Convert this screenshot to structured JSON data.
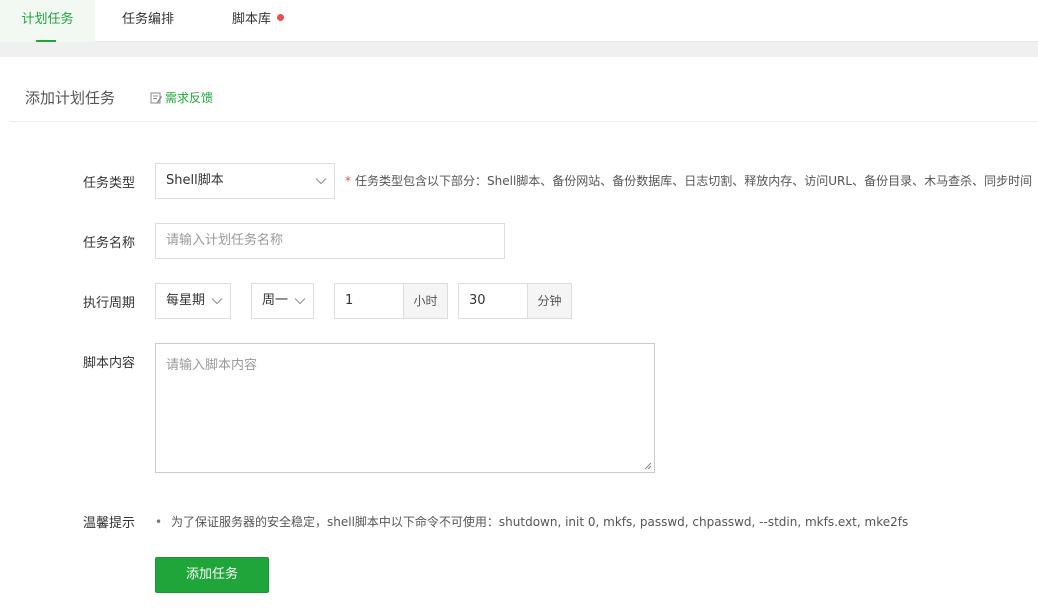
{
  "tabs": [
    {
      "label": "计划任务",
      "active": true
    },
    {
      "label": "任务编排",
      "active": false
    },
    {
      "label": "脚本库",
      "active": false,
      "badge_dot": true
    }
  ],
  "panel": {
    "title": "添加计划任务",
    "feedback_label": "需求反馈",
    "feedback_icon": "edit-icon"
  },
  "form": {
    "task_type": {
      "label": "任务类型",
      "value": "Shell脚本",
      "hint_star": "*",
      "hint": "任务类型包含以下部分：Shell脚本、备份网站、备份数据库、日志切割、释放内存、访问URL、备份目录、木马查杀、同步时间"
    },
    "task_name": {
      "label": "任务名称",
      "placeholder": "请输入计划任务名称",
      "value": ""
    },
    "period": {
      "label": "执行周期",
      "cycle": "每星期",
      "weekday": "周一",
      "hour": "1",
      "hour_unit": "小时",
      "minute": "30",
      "minute_unit": "分钟"
    },
    "script": {
      "label": "脚本内容",
      "placeholder": "请输入脚本内容"
    },
    "tips": {
      "label": "温馨提示",
      "bullet": "•",
      "text": "为了保证服务器的安全稳定，shell脚本中以下命令不可使用：shutdown, init 0, mkfs, passwd, chpasswd, --stdin, mkfs.ext, mke2fs"
    },
    "submit_label": "添加任务"
  },
  "colors": {
    "accent": "#20a53a",
    "badge": "#ef4d4d"
  }
}
